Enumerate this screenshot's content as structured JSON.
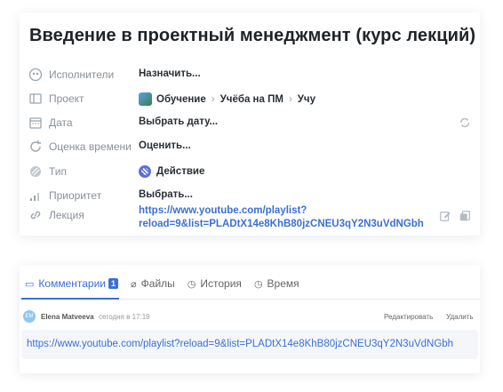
{
  "task": {
    "title": "Введение в проектный менеджмент (курс лекций)",
    "fields": {
      "assignees": {
        "label": "Исполнители",
        "value": "Назначить..."
      },
      "project": {
        "label": "Проект",
        "breadcrumb": [
          "Обучение",
          "Учёба на ПМ",
          "Учу"
        ]
      },
      "date": {
        "label": "Дата",
        "value": "Выбрать дату..."
      },
      "estimate": {
        "label": "Оценка времени",
        "value": "Оценить..."
      },
      "type": {
        "label": "Тип",
        "value": "Действие"
      },
      "priority": {
        "label": "Приоритет",
        "value": "Выбрать..."
      },
      "lecture": {
        "label": "Лекция",
        "value_line1": "https://www.youtube.com/playlist?",
        "value_line2": "reload=9&list=PLADtX14e8KhB80jzCNEU3qY2N3uVdNGbh"
      }
    },
    "icons": {
      "assignees": "people-icon",
      "project": "project-icon",
      "date": "calendar-icon",
      "estimate": "refresh-icon",
      "type": "type-icon",
      "priority": "signal-icon",
      "lecture": "link-icon",
      "date_repeat": "repeat-icon",
      "edit": "edit-icon",
      "copy": "copy-icon"
    }
  },
  "comments_panel": {
    "tabs": [
      {
        "label": "Комментарии",
        "badge": "1",
        "icon": "comment-icon"
      },
      {
        "label": "Файлы",
        "icon": "paperclip-icon"
      },
      {
        "label": "История",
        "icon": "clock-icon"
      },
      {
        "label": "Время",
        "icon": "stopwatch-icon"
      }
    ],
    "comment": {
      "avatar": "EM",
      "author": "Elena Matveeva",
      "time": "сегодня в 17:19",
      "edit_label": "Редактировать",
      "delete_label": "Удалить",
      "text": "https://www.youtube.com/playlist?reload=9&list=PLADtX14e8KhB80jzCNEU3qY2N3uVdNGbh"
    }
  },
  "colors": {
    "accent": "#3b6fd6",
    "muted": "#8a9099"
  }
}
